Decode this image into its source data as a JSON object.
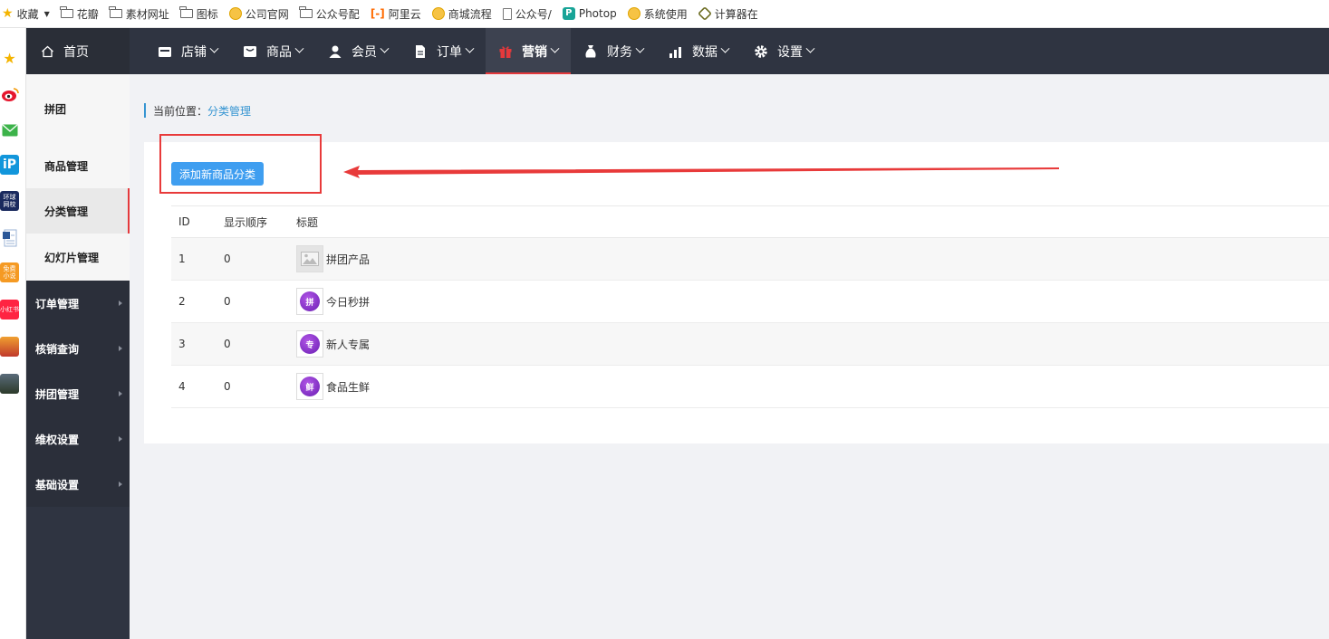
{
  "bookmarks": [
    {
      "icon": "star-icon",
      "label": "收藏"
    },
    {
      "icon": "folder-icon",
      "label": "花瓣"
    },
    {
      "icon": "folder-icon",
      "label": "素材网址"
    },
    {
      "icon": "folder-icon",
      "label": "图标"
    },
    {
      "icon": "globe-icon",
      "label": "公司官网"
    },
    {
      "icon": "folder-icon",
      "label": "公众号配"
    },
    {
      "icon": "aliyun-icon",
      "label": "阿里云"
    },
    {
      "icon": "globe-icon",
      "label": "商城流程"
    },
    {
      "icon": "document-icon",
      "label": "公众号/"
    },
    {
      "icon": "photopea-icon",
      "label": "Photop"
    },
    {
      "icon": "globe-icon",
      "label": "系统使用"
    },
    {
      "icon": "calculator-icon",
      "label": "计算器在"
    }
  ],
  "topnav": {
    "home": "首页",
    "items": [
      {
        "label": "店铺",
        "icon": "store-icon",
        "active": false
      },
      {
        "label": "商品",
        "icon": "goods-icon",
        "active": false
      },
      {
        "label": "会员",
        "icon": "user-icon",
        "active": false
      },
      {
        "label": "订单",
        "icon": "order-icon",
        "active": false
      },
      {
        "label": "营销",
        "icon": "gift-icon",
        "active": true
      },
      {
        "label": "财务",
        "icon": "money-bag-icon",
        "active": false
      },
      {
        "label": "数据",
        "icon": "chart-icon",
        "active": false
      },
      {
        "label": "设置",
        "icon": "gear-icon",
        "active": false
      }
    ]
  },
  "subnav": {
    "items": [
      "拼团",
      "商品管理",
      "分类管理",
      "幻灯片管理"
    ],
    "active": "分类管理"
  },
  "sidebar": {
    "items": [
      "订单管理",
      "核销查询",
      "拼团管理",
      "维权设置",
      "基础设置"
    ]
  },
  "breadcrumb": {
    "prefix": "当前位置：",
    "current": "分类管理"
  },
  "main": {
    "add_button": "添加新商品分类",
    "table": {
      "headers": [
        "ID",
        "显示顺序",
        "标题"
      ],
      "rows": [
        {
          "id": "1",
          "order": "0",
          "title": "拼团产品",
          "thumb": "placeholder",
          "glyph": ""
        },
        {
          "id": "2",
          "order": "0",
          "title": "今日秒拼",
          "thumb": "purple-ball",
          "glyph": "拼"
        },
        {
          "id": "3",
          "order": "0",
          "title": "新人专属",
          "thumb": "purple-ball",
          "glyph": "专"
        },
        {
          "id": "4",
          "order": "0",
          "title": "食品生鲜",
          "thumb": "purple-ball",
          "glyph": "鲜"
        }
      ]
    }
  },
  "colors": {
    "nav_bg": "#2f3441",
    "accent_red": "#e4393c",
    "link_blue": "#3695d2",
    "button_blue": "#3f9ef0",
    "annotation_red": "#e83a3a"
  }
}
